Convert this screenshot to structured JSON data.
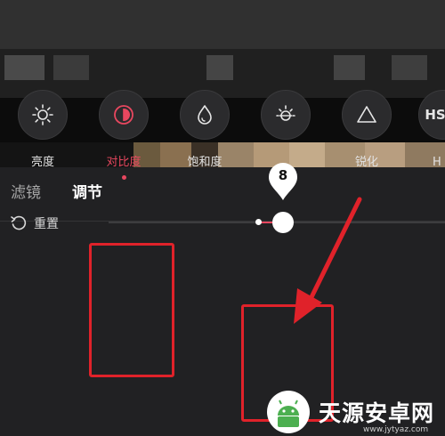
{
  "tabs": {
    "filter": "滤镜",
    "adjust": "调节"
  },
  "tools": [
    {
      "id": "brightness",
      "label": "亮度",
      "icon": "sun-icon"
    },
    {
      "id": "contrast",
      "label": "对比度",
      "icon": "contrast-icon",
      "selected": true
    },
    {
      "id": "saturation",
      "label": "饱和度",
      "icon": "droplet-icon"
    },
    {
      "id": "exposure",
      "label": "",
      "icon": "sun-half-icon"
    },
    {
      "id": "sharpen",
      "label": "锐化",
      "icon": "triangle-icon"
    },
    {
      "id": "hsl",
      "label": "H",
      "icon": "hsl-icon"
    }
  ],
  "reset_label": "重置",
  "slider": {
    "value": "8"
  },
  "watermark": {
    "text": "天源安卓网",
    "url": "www.jytyaz.com"
  },
  "colors": {
    "accent": "#e8475f",
    "annotation": "#e0222a",
    "panel": "#212123"
  }
}
